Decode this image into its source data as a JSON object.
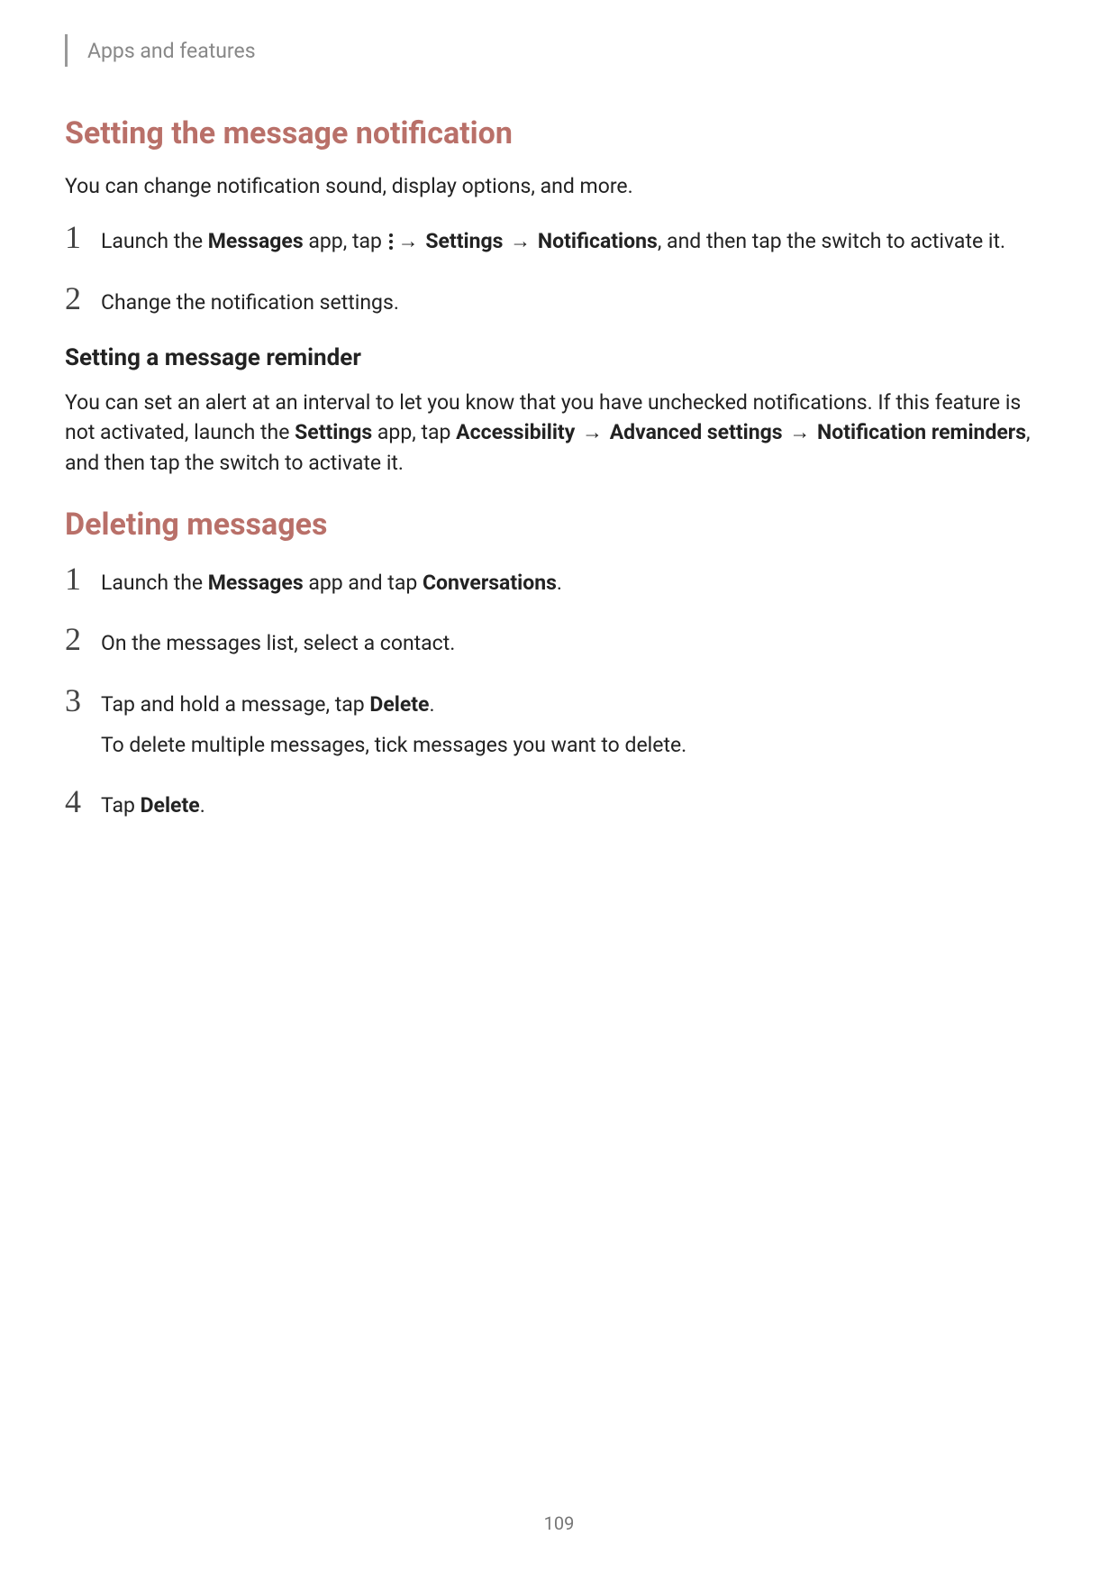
{
  "header": {
    "breadcrumb": "Apps and features"
  },
  "section1": {
    "heading": "Setting the message notification",
    "intro": "You can change notification sound, display options, and more.",
    "steps": [
      {
        "num": "1",
        "prefix": "Launch the ",
        "bold1": "Messages",
        "mid1": " app, tap ",
        "arrow1": "→",
        "bold2": "Settings",
        "arrow2": "→",
        "bold3": "Notifications",
        "suffix": ", and then tap the switch to activate it."
      },
      {
        "num": "2",
        "text": "Change the notification settings."
      }
    ]
  },
  "section2": {
    "subheading": "Setting a message reminder",
    "para_pre": "You can set an alert at an interval to let you know that you have unchecked notifications. If this feature is not activated, launch the ",
    "b1": "Settings",
    "mid1": " app, tap ",
    "b2": "Accessibility",
    "arrow1": "→",
    "b3": "Advanced settings",
    "arrow2": "→",
    "b4": "Notification reminders",
    "suffix": ", and then tap the switch to activate it."
  },
  "section3": {
    "heading": "Deleting messages",
    "steps": [
      {
        "num": "1",
        "pre": "Launch the ",
        "b1": "Messages",
        "mid": " app and tap ",
        "b2": "Conversations",
        "suffix": "."
      },
      {
        "num": "2",
        "text": "On the messages list, select a contact."
      },
      {
        "num": "3",
        "pre": "Tap and hold a message, tap ",
        "b1": "Delete",
        "suffix": ".",
        "sub": "To delete multiple messages, tick messages you want to delete."
      },
      {
        "num": "4",
        "pre": "Tap ",
        "b1": "Delete",
        "suffix": "."
      }
    ]
  },
  "pageNumber": "109"
}
